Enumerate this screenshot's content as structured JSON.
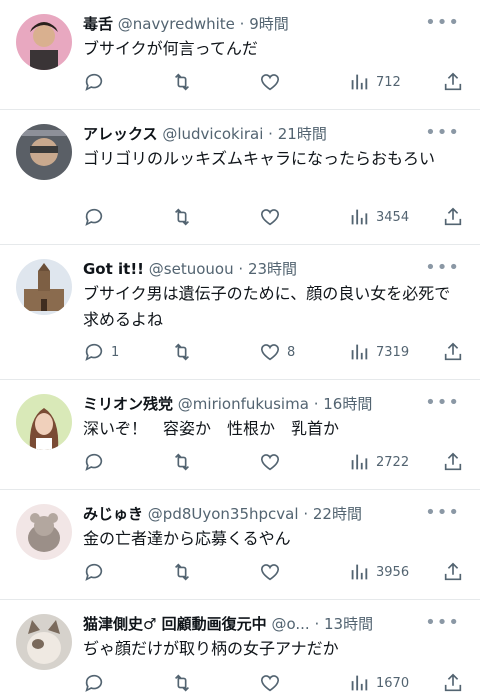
{
  "tweets": [
    {
      "name": "毒舌",
      "handle": "@navyredwhite",
      "time": "9時間",
      "text": "ブサイクが何言ってんだ",
      "replies": "",
      "likes": "",
      "views": "712"
    },
    {
      "name": "アレックス",
      "handle": "@ludvicokirai",
      "time": "21時間",
      "text": "ゴリゴリのルッキズムキャラになったらおもろい",
      "replies": "",
      "likes": "",
      "views": "3454"
    },
    {
      "name": "Got it!!",
      "handle": "@setuouou",
      "time": "23時間",
      "text": "ブサイク男は遺伝子のために、顔の良い女を必死で求めるよね",
      "replies": "1",
      "likes": "8",
      "views": "7319"
    },
    {
      "name": "ミリオン残党",
      "handle": "@mirionfukusima",
      "time": "16時間",
      "text": "深いぞ！　容姿か　性根か　乳首か",
      "replies": "",
      "likes": "",
      "views": "2722"
    },
    {
      "name": "みじゅき",
      "handle": "@pd8Uyon35hpcval",
      "time": "22時間",
      "text": "金の亡者達から応募くるやん",
      "replies": "",
      "likes": "",
      "views": "3956"
    },
    {
      "name": "猫津側史♂ 回顧動画復元中",
      "handle": "@o...",
      "time": "13時間",
      "text": "ぢゃ顔だけが取り柄の女子アナだか",
      "replies": "",
      "likes": "",
      "views": "1670"
    }
  ],
  "separator": "·",
  "more_glyph": "•••",
  "colors": {
    "text": "#0f1419",
    "secondary": "#536471",
    "border": "#e6e9eb"
  }
}
